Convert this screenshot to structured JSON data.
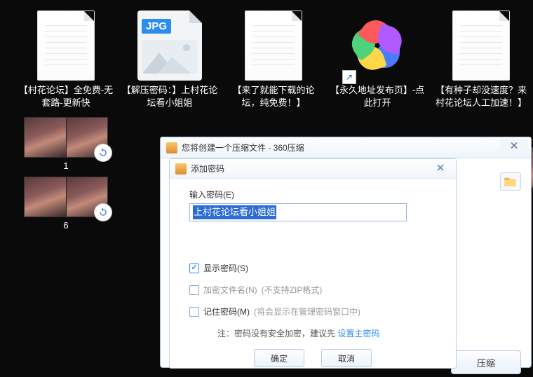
{
  "files": [
    {
      "type": "txt",
      "label": "【村花论坛】全免费-无套路-更新快"
    },
    {
      "type": "jpg",
      "label": "【解压密码：】上村花论坛看小姐姐",
      "jpg_badge": "JPG"
    },
    {
      "type": "txt",
      "label": "【来了就能下载的论坛，纯免费！】"
    },
    {
      "type": "url",
      "label": "【永久地址发布页】-点此打开"
    },
    {
      "type": "txt",
      "label": "【有种子却没速度？来村花论坛人工加速！】"
    }
  ],
  "videos": [
    {
      "caption": "1"
    },
    {
      "caption": "6"
    }
  ],
  "outer_dialog": {
    "title": "您将创建一个压缩文件 - 360压缩",
    "compress_button": "压缩"
  },
  "inner_dialog": {
    "title": "添加密码",
    "password_label": "输入密码(E)",
    "password_value": "上村花论坛看小姐姐",
    "show_password_label": "显示密码(S)",
    "encrypt_filename_label": "加密文件名(N)",
    "encrypt_filename_hint": "(不支持ZIP格式)",
    "remember_password_label": "记住密码(M)",
    "remember_password_hint": "(将会显示在管理密码窗口中)",
    "footnote_prefix": "注：密码没有安全加密，建议先 ",
    "footnote_link": "设置主密码",
    "ok_button": "确定",
    "cancel_button": "取消"
  }
}
